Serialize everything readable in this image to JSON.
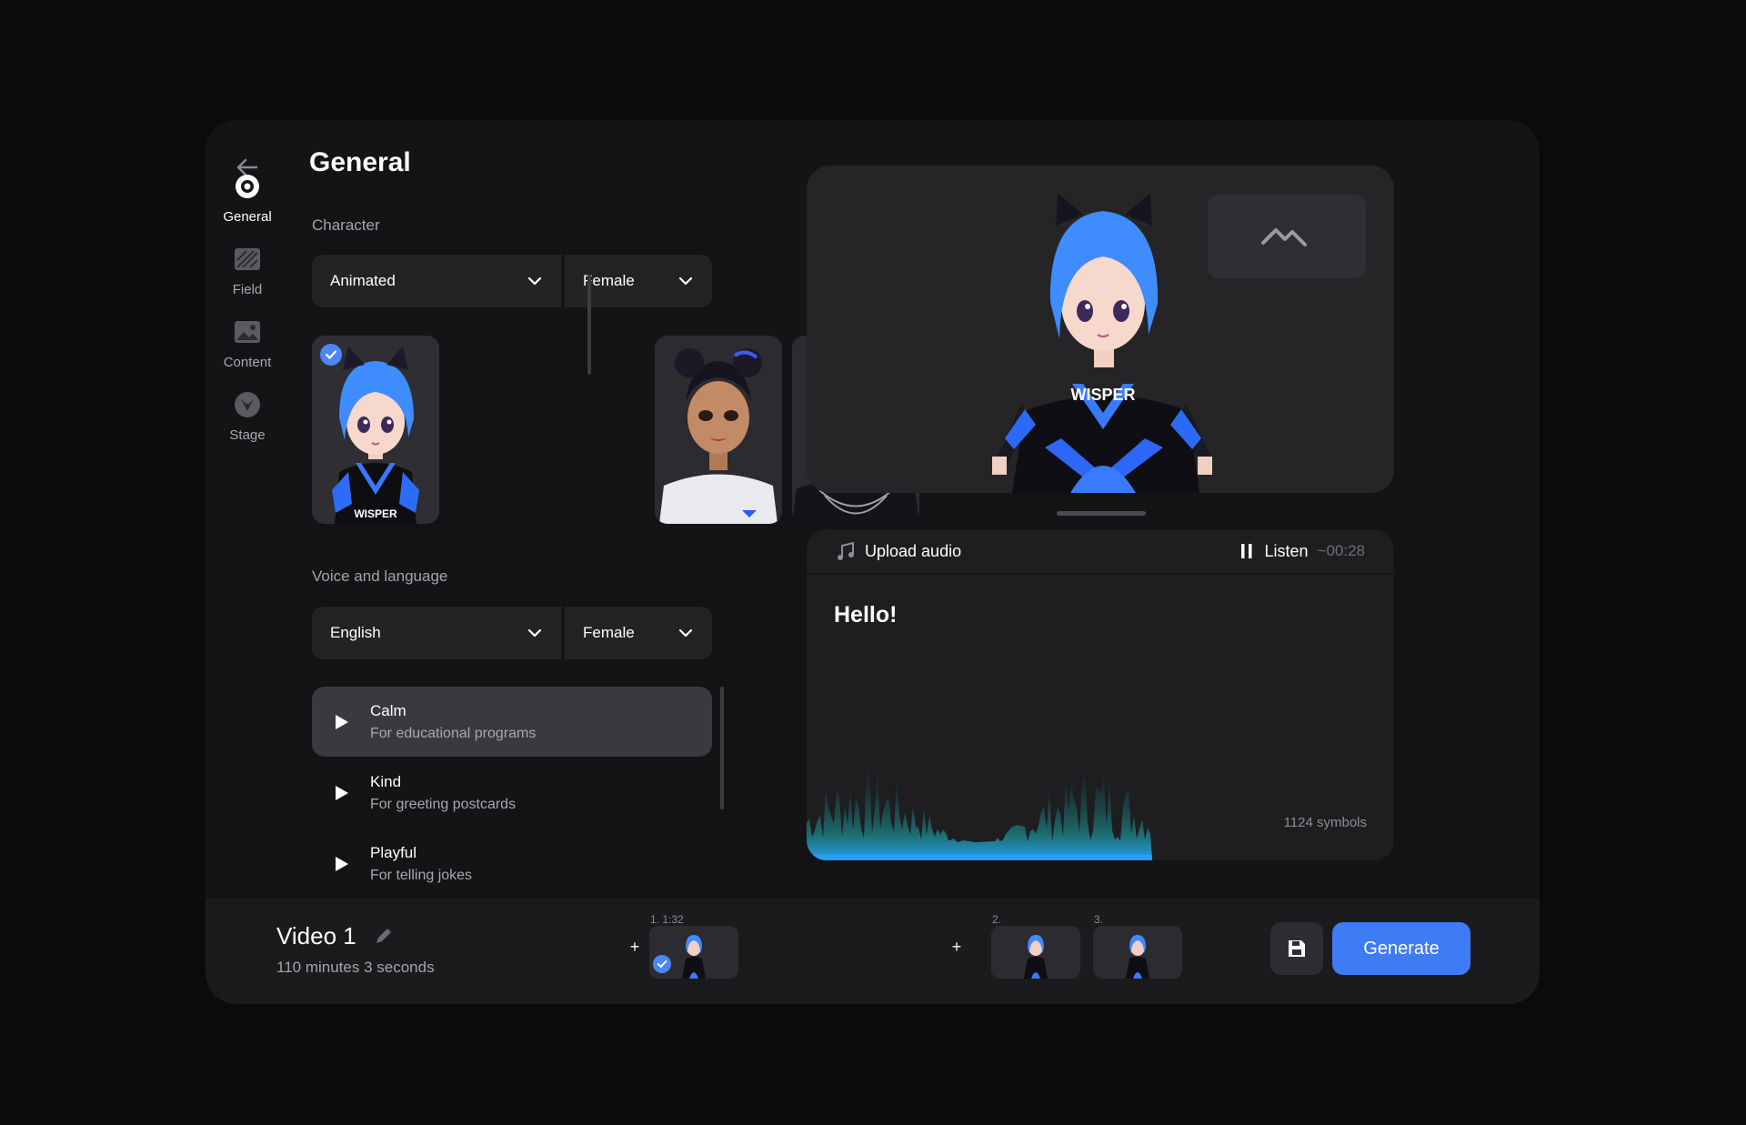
{
  "header": {
    "title": "General"
  },
  "nav": [
    {
      "label": "General",
      "icon": "gear-icon"
    },
    {
      "label": "Field",
      "icon": "texture-icon"
    },
    {
      "label": "Content",
      "icon": "image-icon"
    },
    {
      "label": "Stage",
      "icon": "stage-icon"
    }
  ],
  "character": {
    "section_label": "Character",
    "style_value": "Animated",
    "gender_value": "Female",
    "avatars": [
      {
        "name": "anime-blue-hair",
        "selected": true
      },
      {
        "name": "buns-hair",
        "selected": false
      },
      {
        "name": "teal-bob-hair",
        "selected": false
      }
    ]
  },
  "voice": {
    "section_label": "Voice and language",
    "language_value": "English",
    "gender_value": "Female",
    "options": [
      {
        "title": "Calm",
        "subtitle": "For educational programs",
        "active": true
      },
      {
        "title": "Kind",
        "subtitle": "For greeting postcards",
        "active": false
      },
      {
        "title": "Playful",
        "subtitle": "For telling jokes",
        "active": false
      }
    ]
  },
  "preview": {
    "shirt_text": "WISPER"
  },
  "audio": {
    "upload_label": "Upload audio",
    "listen_label": "Listen",
    "duration": "~00:28",
    "text": "Hello!",
    "symbols": "1124 symbols"
  },
  "bottom": {
    "video_title": "Video 1",
    "video_duration": "110 minutes 3 seconds",
    "scenes": [
      {
        "label": "1. 1:32",
        "selected": true
      },
      {
        "label": "2.",
        "selected": false
      },
      {
        "label": "3.",
        "selected": false
      }
    ],
    "generate_label": "Generate"
  },
  "colors": {
    "accent": "#3d7cf5",
    "background": "#0b0b0c",
    "panel": "#141416"
  }
}
